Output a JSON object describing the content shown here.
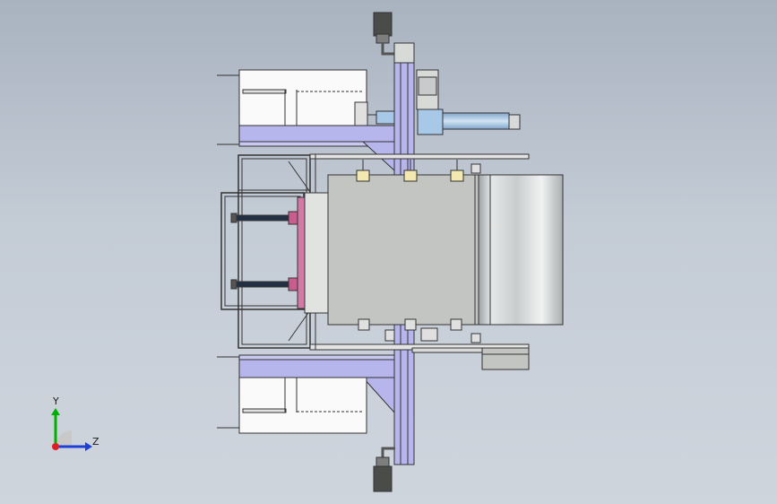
{
  "triad": {
    "y_label": "Y",
    "z_label": "Z"
  },
  "colors": {
    "frame_purple": "#b6b6ec",
    "steel_gray": "#c3c5c2",
    "roller": "#d6d8da",
    "cylinder_blue": "#a8c8e8",
    "outline": "#333333",
    "pink": "#c95d8d",
    "axis_y": "#00b000",
    "axis_z": "#1e3fd6",
    "axis_x": "#e02020"
  }
}
